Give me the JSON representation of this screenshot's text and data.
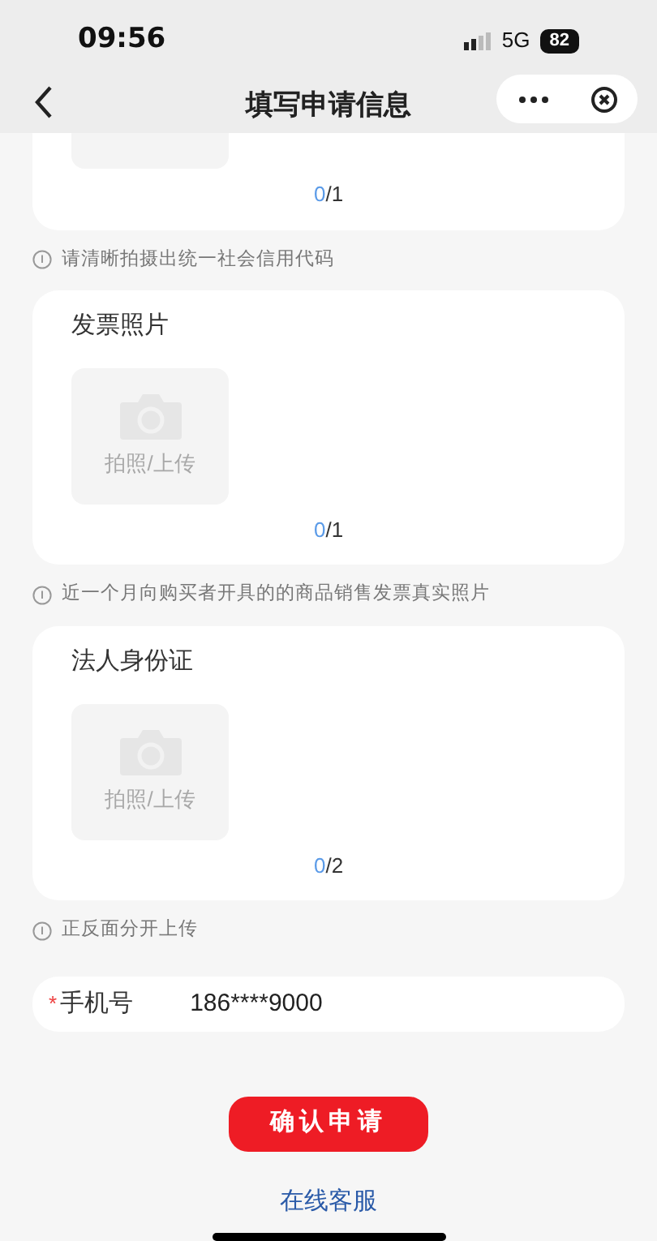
{
  "status_bar": {
    "time": "09:56",
    "network": "5G",
    "battery": "82"
  },
  "header": {
    "title": "填写申请信息"
  },
  "upload_sections": [
    {
      "uploaded": "0",
      "separator": "/",
      "max": "1",
      "hint": "请清晰拍摄出统一社会信用代码"
    },
    {
      "title": "发票照片",
      "tile_label": "拍照/上传",
      "uploaded": "0",
      "separator": "/",
      "max": "1",
      "hint": "近一个月向购买者开具的的商品销售发票真实照片"
    },
    {
      "title": "法人身份证",
      "tile_label": "拍照/上传",
      "uploaded": "0",
      "separator": "/",
      "max": "2",
      "hint": "正反面分开上传"
    }
  ],
  "phone_field": {
    "label": "手机号",
    "required": true,
    "required_mark": "*",
    "value": "186****9000"
  },
  "submit_button": "确认申请",
  "service_link": "在线客服"
}
